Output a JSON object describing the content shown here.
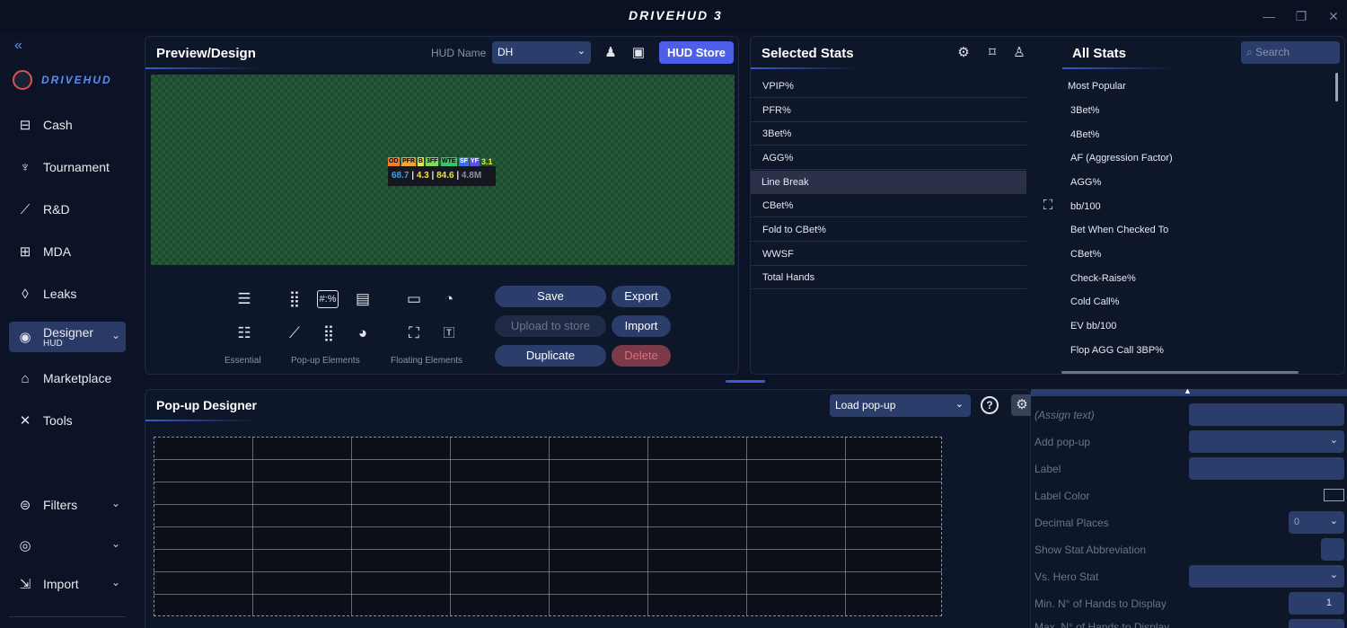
{
  "app": {
    "title": "DRIVEHUD 3",
    "brand": "DRIVEHUD",
    "window_controls": {
      "minimize": "—",
      "restore": "❐",
      "close": "✕"
    }
  },
  "sidebar": {
    "collapse_icon": "«",
    "items": [
      {
        "label": "Cash",
        "icon": "cash-icon"
      },
      {
        "label": "Tournament",
        "icon": "trophy-icon"
      },
      {
        "label": "R&D",
        "icon": "chart-icon"
      },
      {
        "label": "MDA",
        "icon": "mda-icon"
      },
      {
        "label": "Leaks",
        "icon": "drop-icon"
      },
      {
        "label": "Designer",
        "sublabel": "HUD",
        "icon": "eye-icon"
      },
      {
        "label": "Marketplace",
        "icon": "store-icon"
      },
      {
        "label": "Tools",
        "icon": "tools-icon"
      },
      {
        "label": "Filters",
        "icon": "filter-icon"
      },
      {
        "label": "",
        "icon": "user-icon"
      },
      {
        "label": "Import",
        "icon": "import-icon"
      }
    ]
  },
  "preview": {
    "title": "Preview/Design",
    "hud_name_label": "HUD Name",
    "hud_name_value": "DH",
    "hud_store_label": "HUD Store",
    "hud_tags": [
      "OD",
      "PFR",
      "B",
      "3FF",
      "WTE",
      "SF",
      "YF"
    ],
    "hud_values": [
      "68.7",
      "4.3",
      "84.6",
      "4.8M"
    ],
    "hud_extra_value": "3.1",
    "tool_groups": [
      "Essential",
      "Pop-up Elements",
      "Floating Elements"
    ],
    "buttons": {
      "save": "Save",
      "export": "Export",
      "upload": "Upload to store",
      "import": "Import",
      "duplicate": "Duplicate",
      "delete": "Delete"
    }
  },
  "selected_stats": {
    "title": "Selected Stats",
    "items": [
      "VPIP%",
      "PFR%",
      "3Bet%",
      "AGG%",
      "Line Break",
      "CBet%",
      "Fold to CBet%",
      "WWSF",
      "Total Hands"
    ],
    "selected_index": 4
  },
  "all_stats": {
    "title": "All Stats",
    "search_placeholder": "Search",
    "group": "Most Popular",
    "items": [
      "3Bet%",
      "4Bet%",
      "AF (Aggression Factor)",
      "AGG%",
      "bb/100",
      "Bet When Checked To",
      "CBet%",
      "Check-Raise%",
      "Cold Call%",
      "EV bb/100",
      "Flop AGG Call 3BP%"
    ]
  },
  "popup_designer": {
    "title": "Pop-up Designer",
    "load_label": "Load pop-up",
    "help": "?"
  },
  "properties": {
    "assign_text": "(Assign text)",
    "add_popup": "Add pop-up",
    "label": "Label",
    "label_color": "Label Color",
    "decimal_places": "Decimal Places",
    "decimal_value": "0",
    "show_abbrev": "Show Stat Abbreviation",
    "vs_hero": "Vs. Hero Stat",
    "min_hands": "Min. N° of Hands to Display",
    "min_hands_value": "1",
    "max_hands": "Max. N° of Hands to Display"
  },
  "colors": {
    "accent": "#4d5ee8",
    "selected_bg": "#2a3a66",
    "danger": "#e36b78",
    "tag_od": "#f07e2a",
    "tag_pfr": "#f2a33a",
    "tag_b": "#f2e33a",
    "tag_3ff": "#7fdc5a",
    "tag_wte": "#3ac46a",
    "tag_sf": "#3a6ef2",
    "tag_yf": "#5a4ef2"
  }
}
